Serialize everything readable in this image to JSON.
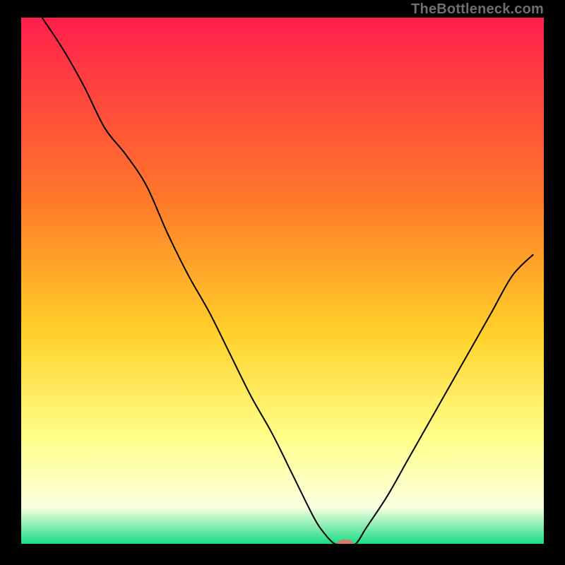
{
  "watermark": "TheBottleneck.com",
  "colors": {
    "black": "#000000",
    "curve": "#000000",
    "marker_fill": "#d9786a",
    "grad_top": "#ff1f4c",
    "grad_mid1": "#ff7a2a",
    "grad_mid2": "#ffd12a",
    "grad_mid3": "#ffff8a",
    "grad_mid4": "#fbffe0",
    "grad_bottom": "#1cdc87"
  },
  "chart_data": {
    "type": "line",
    "title": "",
    "xlabel": "",
    "ylabel": "",
    "xlim": [
      0,
      100
    ],
    "ylim": [
      0,
      100
    ],
    "x": [
      4,
      8,
      12,
      16,
      20,
      24,
      28,
      32,
      36,
      40,
      44,
      48,
      52,
      56,
      58,
      60,
      62,
      64,
      66,
      70,
      74,
      78,
      82,
      86,
      90,
      94,
      98
    ],
    "values": [
      100,
      94,
      87,
      79,
      74,
      68,
      59,
      51,
      44,
      36,
      28,
      21,
      13,
      5,
      2,
      0,
      0,
      0,
      3,
      9,
      16,
      23,
      30,
      37,
      44,
      51,
      55
    ],
    "marker": {
      "x": 62,
      "y": 0,
      "rx": 1.6,
      "ry": 0.8
    }
  }
}
